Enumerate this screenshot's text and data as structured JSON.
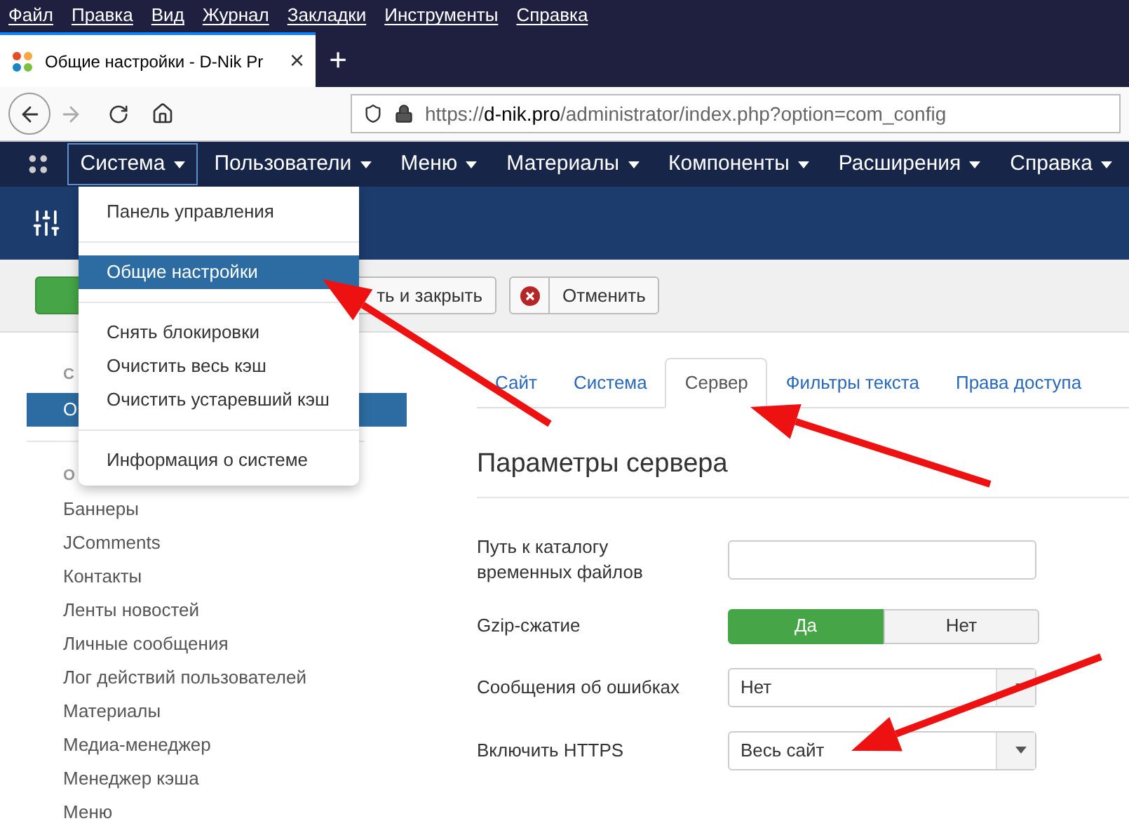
{
  "browser_menu": [
    "Файл",
    "Правка",
    "Вид",
    "Журнал",
    "Закладки",
    "Инструменты",
    "Справка"
  ],
  "browser_tab": {
    "title": "Общие настройки - D-Nik Pr",
    "close": "×",
    "new_tab": "+"
  },
  "address_bar": {
    "url_scheme": "https://",
    "url_host": "d-nik.pro",
    "url_path": "/administrator/index.php?option=com_config"
  },
  "nav": [
    {
      "label": "Система",
      "selected": true
    },
    {
      "label": "Пользователи",
      "selected": false
    },
    {
      "label": "Меню",
      "selected": false
    },
    {
      "label": "Материалы",
      "selected": false
    },
    {
      "label": "Компоненты",
      "selected": false
    },
    {
      "label": "Расширения",
      "selected": false
    },
    {
      "label": "Справка",
      "selected": false
    }
  ],
  "dropdown": [
    {
      "label": "Панель управления",
      "selected": false,
      "divider_before": false
    },
    {
      "label": "Общие настройки",
      "selected": true,
      "divider_before": true
    },
    {
      "label": "Снять блокировки",
      "selected": false,
      "divider_before": true
    },
    {
      "label": "Очистить весь кэш",
      "selected": false,
      "divider_before": false
    },
    {
      "label": "Очистить устаревший кэш",
      "selected": false,
      "divider_before": false
    },
    {
      "label": "Информация о системе",
      "selected": false,
      "divider_before": true
    }
  ],
  "toolbar": {
    "save_close": "ть и закрыть",
    "cancel": "Отменить"
  },
  "sidebar": [
    {
      "heading": "С",
      "items": [
        {
          "label": "О",
          "selected": true
        }
      ]
    },
    {
      "heading": "О",
      "items": [
        {
          "label": "Баннеры",
          "selected": false
        },
        {
          "label": "JComments",
          "selected": false
        },
        {
          "label": "Контакты",
          "selected": false
        },
        {
          "label": "Ленты новостей",
          "selected": false
        },
        {
          "label": "Личные сообщения",
          "selected": false
        },
        {
          "label": "Лог действий пользователей",
          "selected": false
        },
        {
          "label": "Материалы",
          "selected": false
        },
        {
          "label": "Медиа-менеджер",
          "selected": false
        },
        {
          "label": "Менеджер кэша",
          "selected": false
        },
        {
          "label": "Меню",
          "selected": false
        }
      ]
    }
  ],
  "tabs": [
    {
      "label": "Сайт",
      "selected": false
    },
    {
      "label": "Система",
      "selected": false
    },
    {
      "label": "Сервер",
      "selected": true
    },
    {
      "label": "Фильтры текста",
      "selected": false
    },
    {
      "label": "Права доступа",
      "selected": false
    }
  ],
  "section_title": "Параметры сервера",
  "fields": [
    {
      "kind": "text",
      "label": "Путь к каталогу временных файлов"
    },
    {
      "kind": "toggle",
      "label": "Gzip-сжатие",
      "options": [
        {
          "label": "Да",
          "selected": true
        },
        {
          "label": "Нет",
          "selected": false
        }
      ]
    },
    {
      "kind": "select",
      "label": "Сообщения об ошибках",
      "value": "Нет"
    },
    {
      "kind": "select",
      "label": "Включить HTTPS",
      "value": "Весь сайт"
    }
  ]
}
